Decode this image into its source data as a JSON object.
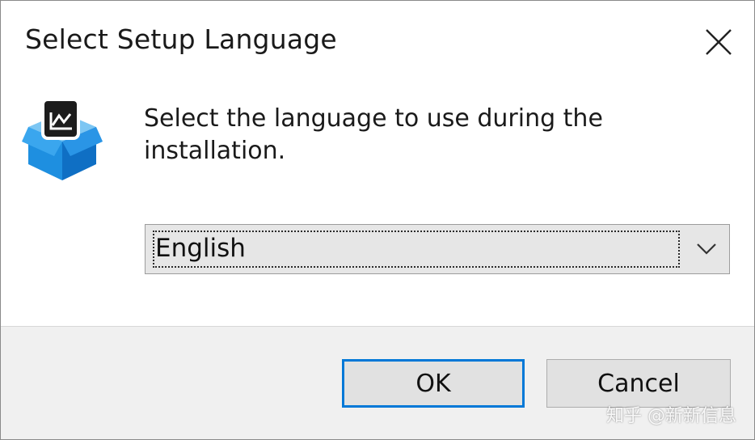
{
  "dialog": {
    "title": "Select Setup Language",
    "close_icon": "close-icon",
    "app_icon": "setup-package-icon",
    "prompt": "Select the language to use during the installation.",
    "language_select": {
      "selected": "English",
      "arrow_icon": "chevron-down-icon"
    },
    "buttons": {
      "ok_label": "OK",
      "cancel_label": "Cancel"
    },
    "watermark": "知乎 @新新信息"
  },
  "colors": {
    "accent": "#0078d7",
    "footer_bg": "#f0f0f0",
    "select_bg": "#e6e6e6"
  }
}
